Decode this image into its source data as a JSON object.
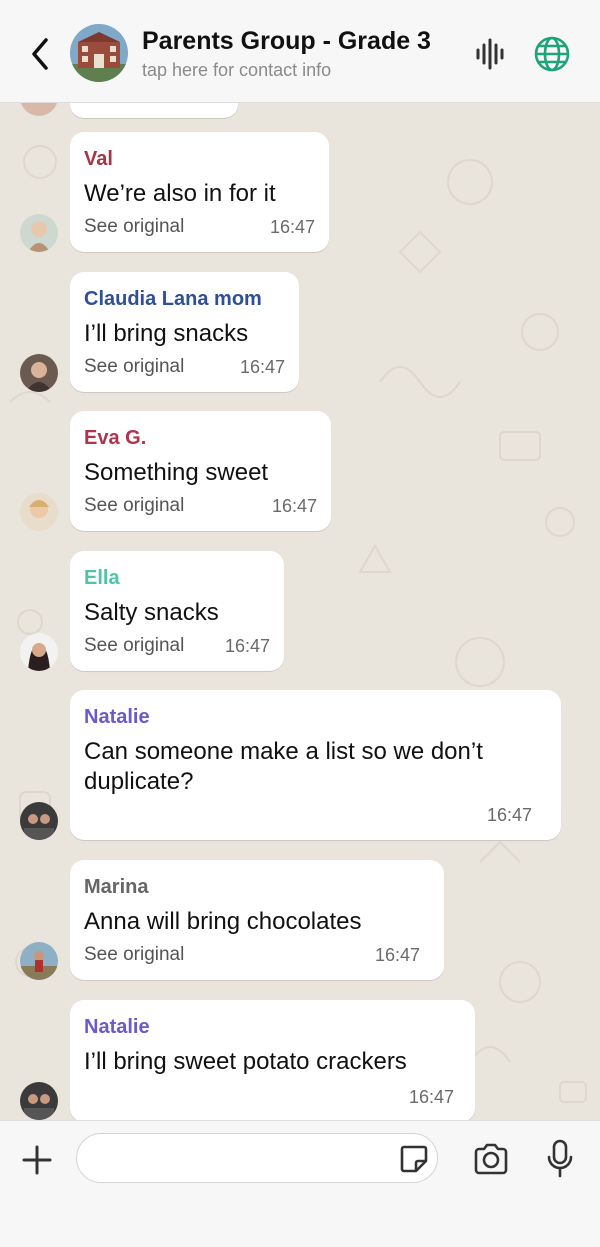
{
  "header": {
    "title": "Parents Group - Grade 3",
    "subtitle": "tap here for contact info",
    "icons": [
      "back-chevron-icon",
      "group-avatar",
      "voice-waveform-icon",
      "globe-icon"
    ]
  },
  "messages": [
    {
      "sender": "Val",
      "sender_color": "#a8344a",
      "text_lines": [
        "We’re also in for it"
      ],
      "see_original": "See original",
      "time": "16:47"
    },
    {
      "sender": "Claudia Lana mom",
      "sender_color": "#2f4f9a",
      "text_lines": [
        "I’ll bring snacks"
      ],
      "see_original": "See original",
      "time": "16:47"
    },
    {
      "sender": "Eva G.",
      "sender_color": "#b0344e",
      "text_lines": [
        "Something sweet"
      ],
      "see_original": "See original",
      "time": "16:47"
    },
    {
      "sender": "Ella",
      "sender_color": "#4fc4a8",
      "text_lines": [
        "Salty snacks"
      ],
      "see_original": "See original",
      "time": "16:47"
    },
    {
      "sender": "Natalie",
      "sender_color": "#6a5acd",
      "text_lines": [
        "Can someone make a list so we don’t",
        "duplicate?"
      ],
      "time": "16:47"
    },
    {
      "sender": "Marina",
      "sender_color": "#666666",
      "text_lines": [
        "Anna will bring chocolates"
      ],
      "see_original": "See original",
      "time": "16:47"
    },
    {
      "sender": "Natalie",
      "sender_color": "#6a5acd",
      "text_lines": [
        "I’ll bring sweet potato crackers"
      ],
      "time": "16:47"
    }
  ],
  "input": {
    "placeholder": "",
    "icons": [
      "plus-icon",
      "sticker-icon",
      "camera-icon",
      "mic-icon"
    ]
  },
  "colors": {
    "chat_background": "#e9e4dc",
    "bubble": "#ffffff",
    "accent_green": "#1fa37a"
  }
}
